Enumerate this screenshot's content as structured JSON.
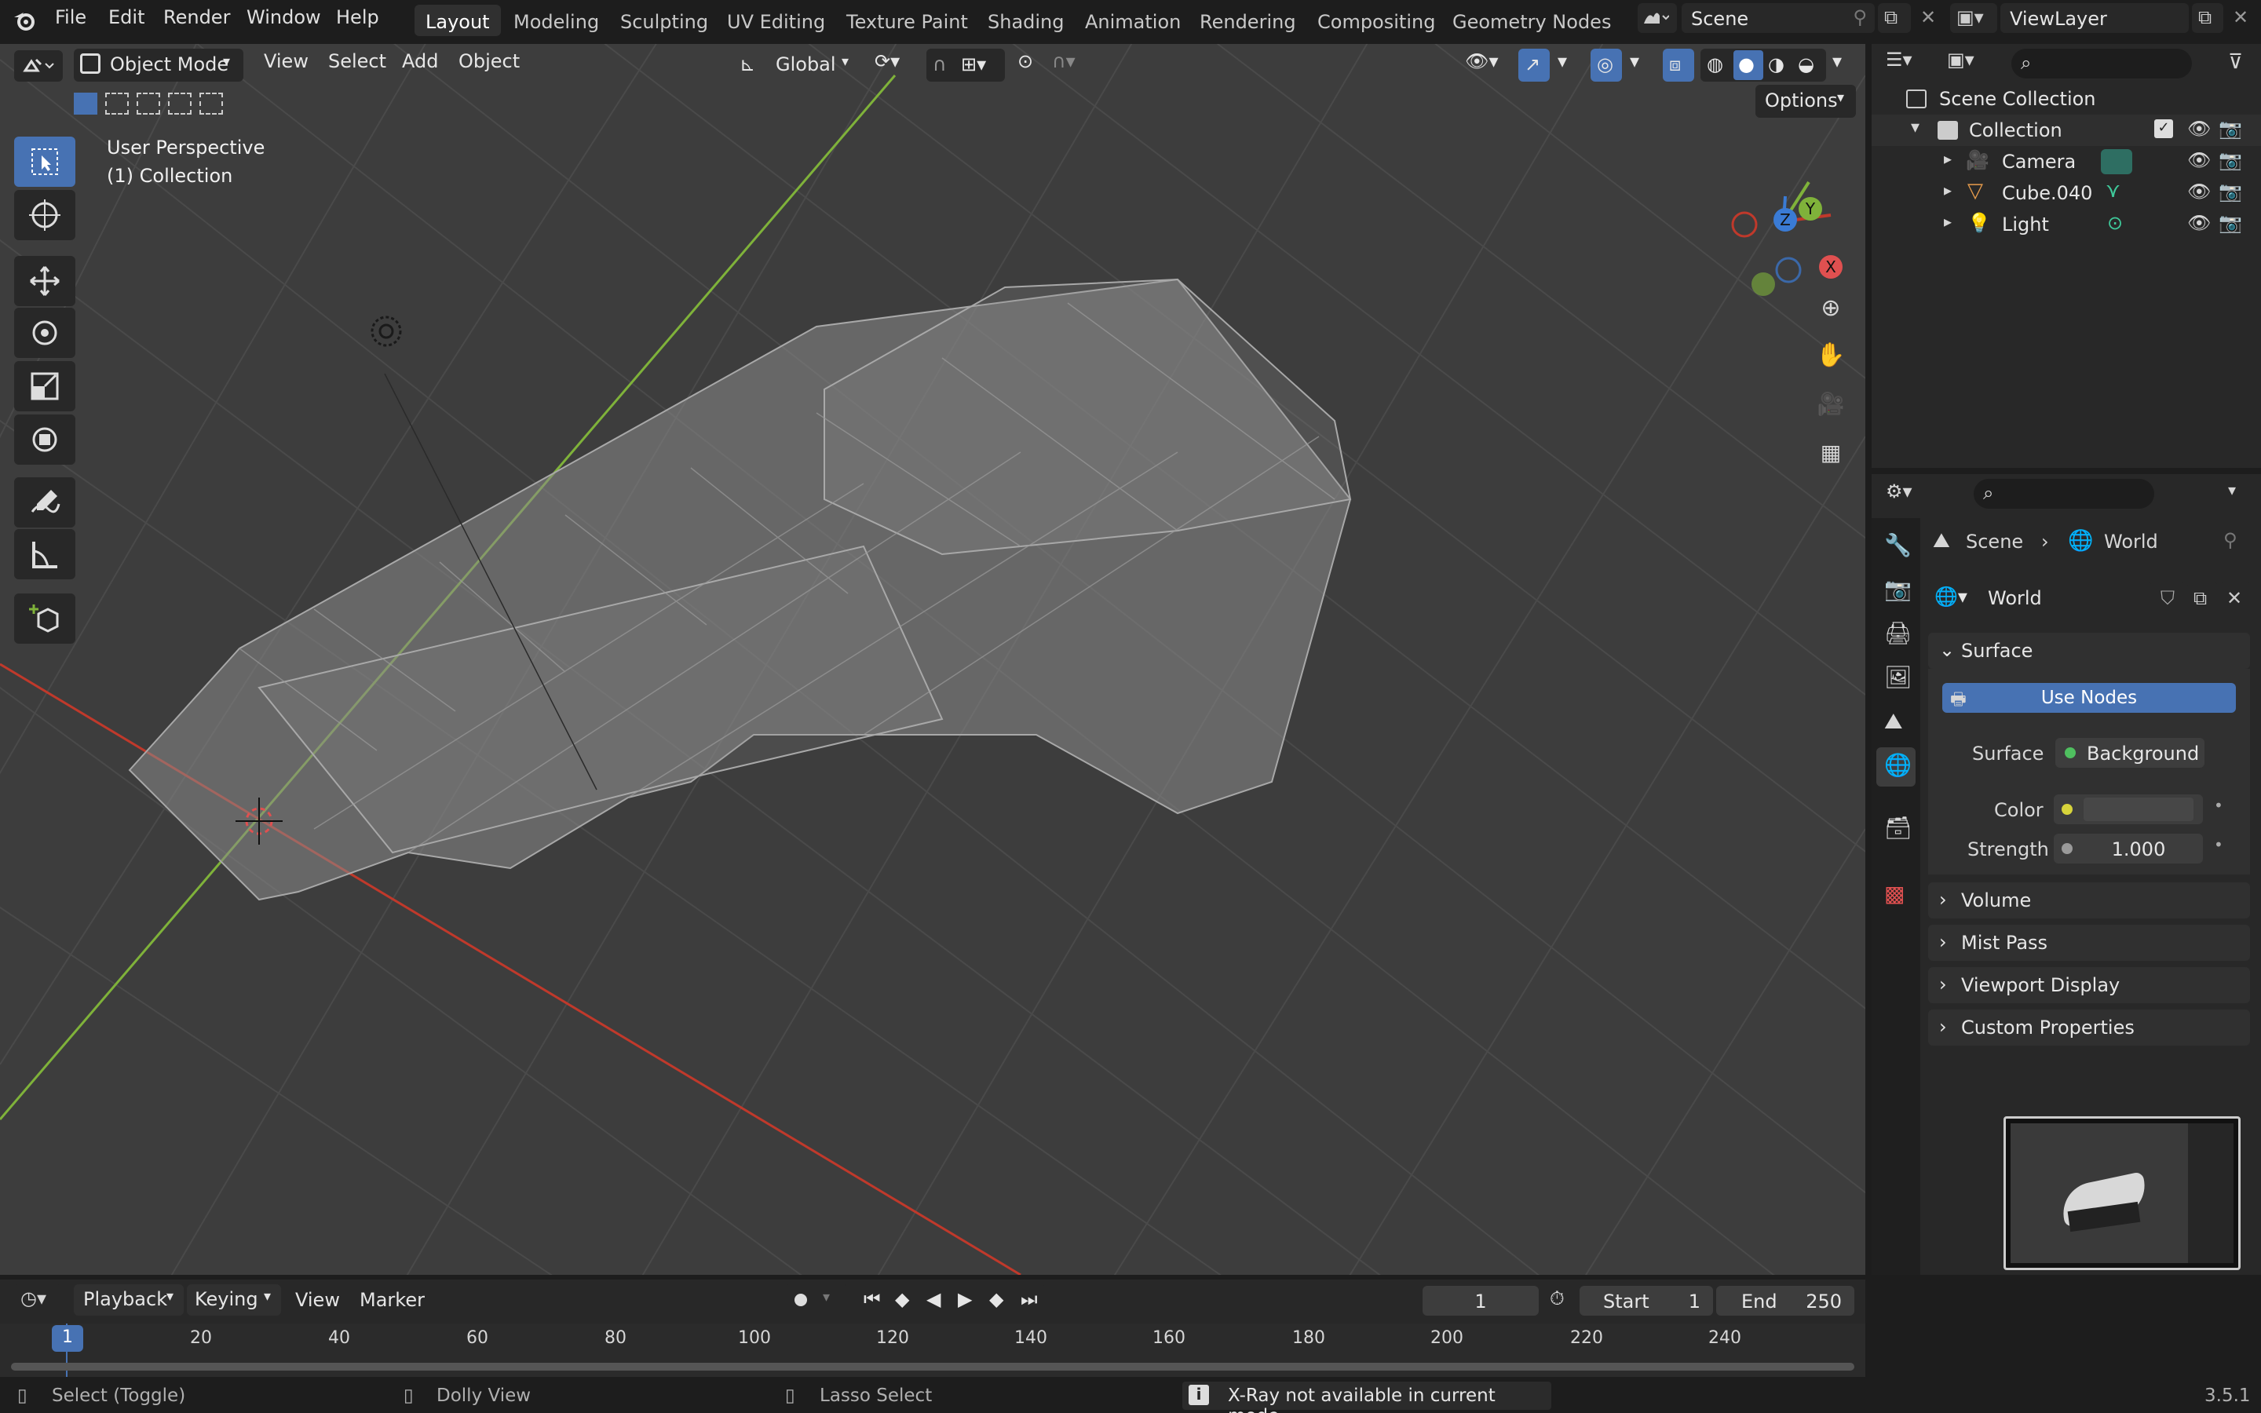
{
  "menu": {
    "file": "File",
    "edit": "Edit",
    "render": "Render",
    "window": "Window",
    "help": "Help"
  },
  "workspaces": [
    "Layout",
    "Modeling",
    "Sculpting",
    "UV Editing",
    "Texture Paint",
    "Shading",
    "Animation",
    "Rendering",
    "Compositing",
    "Geometry Nodes"
  ],
  "scene_field": "Scene",
  "viewlayer_field": "ViewLayer",
  "viewport": {
    "mode": "Object Mode",
    "menus": {
      "view": "View",
      "select": "Select",
      "add": "Add",
      "object": "Object"
    },
    "transform_orientation": "Global",
    "options_label": "Options",
    "overlay_text": {
      "line1": "User Perspective",
      "line2": "(1) Collection"
    },
    "gizmo": {
      "z": "Z",
      "y": "Y",
      "x": "X"
    }
  },
  "outliner": {
    "root": "Scene Collection",
    "collection": "Collection",
    "items": [
      {
        "label": "Camera"
      },
      {
        "label": "Cube.040"
      },
      {
        "label": "Light"
      }
    ]
  },
  "properties": {
    "breadcrumb": {
      "scene": "Scene",
      "world": "World"
    },
    "world_name": "World",
    "surface_panel": "Surface",
    "use_nodes": "Use Nodes",
    "surface_label": "Surface",
    "surface_value": "Background",
    "color_label": "Color",
    "strength_label": "Strength",
    "strength_value": "1.000",
    "panels": [
      "Volume",
      "Mist Pass",
      "Viewport Display",
      "Custom Properties"
    ]
  },
  "timeline": {
    "menus": {
      "playback": "Playback",
      "keying": "Keying",
      "view": "View",
      "marker": "Marker"
    },
    "current_frame": "1",
    "start_label": "Start",
    "start_value": "1",
    "end_label": "End",
    "end_value": "250",
    "ruler": [
      "1",
      "20",
      "40",
      "60",
      "80",
      "100",
      "120",
      "140",
      "160",
      "180",
      "200",
      "220",
      "240"
    ]
  },
  "status": {
    "select": "Select (Toggle)",
    "dolly": "Dolly View",
    "lasso": "Lasso Select",
    "message": "X-Ray not available in current mode",
    "version": "3.5.1"
  },
  "colors": {
    "accent": "#4772b3",
    "x_axis": "#c0392b",
    "y_axis": "#7fb23a",
    "z_axis": "#3a7bd5"
  }
}
